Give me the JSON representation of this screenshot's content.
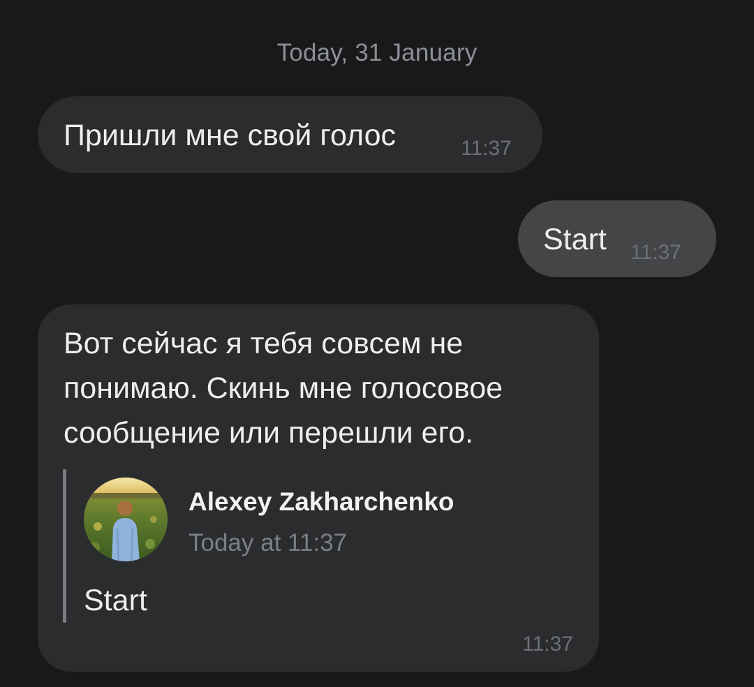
{
  "chat": {
    "date_separator": "Today, 31 January",
    "messages": [
      {
        "direction": "incoming",
        "text": "Пришли мне свой голос",
        "time": "11:37"
      },
      {
        "direction": "outgoing",
        "text": "Start",
        "time": "11:37"
      },
      {
        "direction": "incoming",
        "lines": [
          "Вот сейчас я тебя совсем не",
          "понимаю. Скинь мне голосовое",
          "сообщение или перешли его."
        ],
        "forwarded": {
          "author": "Alexey Zakharchenko",
          "date": "Today at 11:37",
          "text": "Start",
          "avatar_icon": "user-avatar-photo"
        },
        "time": "11:37"
      }
    ]
  },
  "colors": {
    "background": "#19191a",
    "incoming_bubble": "#2b2c2e",
    "outgoing_bubble": "#434547",
    "secondary_text": "#8b9098"
  }
}
